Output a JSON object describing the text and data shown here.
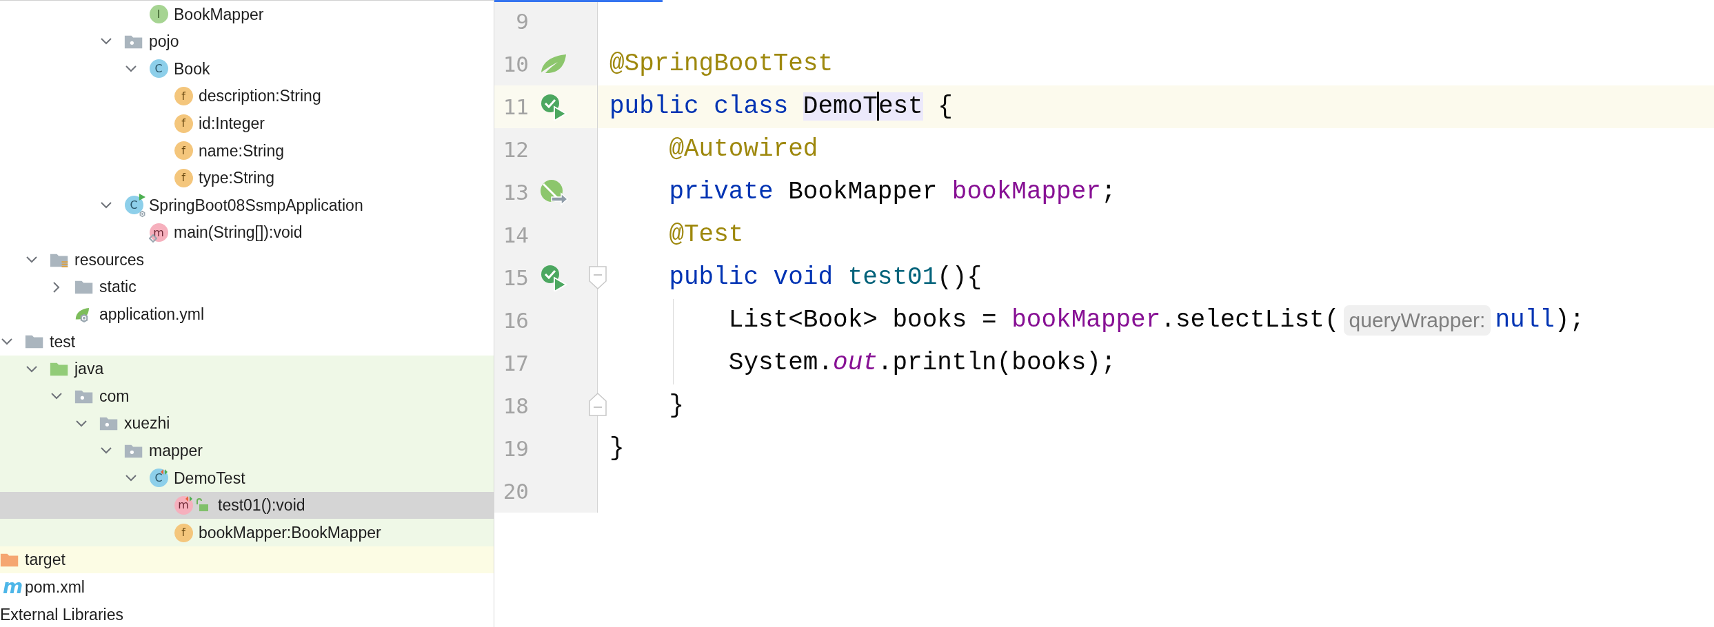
{
  "project_tree": {
    "fragments": [
      {
        "items": [
          {
            "label": "BookMapper",
            "kind": "interface",
            "badge": "I",
            "selected": false
          }
        ]
      },
      {
        "items": [
          {
            "label": "pojo",
            "kind": "package",
            "expanded": true,
            "selected": false,
            "children": [
              {
                "label": "Book",
                "kind": "class",
                "badge": "C",
                "expanded": true,
                "selected": false,
                "children": [
                  {
                    "label": "description:String",
                    "kind": "field",
                    "badge": "f",
                    "selected": false
                  },
                  {
                    "label": "id:Integer",
                    "kind": "field",
                    "badge": "f",
                    "selected": false
                  },
                  {
                    "label": "name:String",
                    "kind": "field",
                    "badge": "f",
                    "selected": false
                  },
                  {
                    "label": "type:String",
                    "kind": "field",
                    "badge": "f",
                    "selected": false
                  }
                ]
              }
            ]
          },
          {
            "label": "SpringBoot08SsmpApplication",
            "kind": "app-class",
            "badge": "C",
            "expanded": true,
            "selected": false,
            "children": [
              {
                "label": "main(String[]):void",
                "kind": "main-method",
                "badge": "m",
                "selected": false
              }
            ]
          }
        ]
      },
      {
        "items": [
          {
            "label": "resources",
            "kind": "resources",
            "expanded": true,
            "selected": false,
            "children": [
              {
                "label": "static",
                "kind": "folder",
                "expanded": false,
                "selected": false
              },
              {
                "label": "application.yml",
                "kind": "yml",
                "selected": false
              }
            ]
          }
        ]
      },
      {
        "items": [
          {
            "label": "test",
            "kind": "folder",
            "expanded": true,
            "selected": false,
            "children": [
              {
                "label": "java",
                "kind": "test-root",
                "expanded": true,
                "test_source": true,
                "selected": false,
                "children": [
                  {
                    "label": "com",
                    "kind": "package",
                    "expanded": true,
                    "test_source": true,
                    "selected": false,
                    "children": [
                      {
                        "label": "xuezhi",
                        "kind": "package",
                        "expanded": true,
                        "test_source": true,
                        "selected": false,
                        "children": [
                          {
                            "label": "mapper",
                            "kind": "package",
                            "expanded": true,
                            "test_source": true,
                            "selected": false,
                            "children": [
                              {
                                "label": "DemoTest",
                                "kind": "test-class",
                                "badge": "C",
                                "expanded": true,
                                "test_source": true,
                                "selected": false,
                                "children": [
                                  {
                                    "label": "test01():void",
                                    "kind": "test-method",
                                    "badge": "m",
                                    "package_private": true,
                                    "test_source": true,
                                    "selected": true
                                  },
                                  {
                                    "label": "bookMapper:BookMapper",
                                    "kind": "field",
                                    "badge": "f",
                                    "test_source": true,
                                    "selected": false
                                  }
                                ]
                              }
                            ]
                          }
                        ]
                      }
                    ]
                  }
                ]
              }
            ]
          }
        ]
      },
      {
        "items": [
          {
            "label": "target",
            "kind": "excluded",
            "excluded": true,
            "selected": false
          },
          {
            "label": "pom.xml",
            "kind": "maven",
            "badge": "m",
            "selected": false
          }
        ]
      },
      {
        "items": [
          {
            "label": "External Libraries",
            "kind": "library",
            "selected": false
          }
        ]
      }
    ]
  },
  "editor": {
    "lines": [
      {
        "number": "9",
        "current": false
      },
      {
        "number": "10",
        "gutter_icon": {
          "kind": "spring"
        },
        "current": false,
        "tokens": [
          {
            "text": "@SpringBootTest",
            "kind": "annotation"
          }
        ]
      },
      {
        "number": "11",
        "gutter_icon": {
          "kind": "run"
        },
        "current": true,
        "tokens": [
          {
            "text": "public class ",
            "kind": "keyword"
          },
          {
            "text": "DemoT",
            "kind": "usage",
            "caret": true
          },
          {
            "text": "est",
            "kind": "usage"
          },
          {
            "text": " {",
            "kind": "plain"
          }
        ],
        "children": [
          {
            "number": "12",
            "current": false,
            "tokens": [
              {
                "text": "@Autowired",
                "kind": "annotation"
              }
            ]
          },
          {
            "number": "13",
            "gutter_icon": {
              "kind": "bean"
            },
            "current": false,
            "tokens": [
              {
                "text": "private ",
                "kind": "keyword"
              },
              {
                "text": "BookMapper ",
                "kind": "plain"
              },
              {
                "text": "bookMapper",
                "kind": "field"
              },
              {
                "text": ";",
                "kind": "plain"
              }
            ]
          },
          {
            "number": "14",
            "current": false,
            "tokens": [
              {
                "text": "@Test",
                "kind": "annotation"
              }
            ]
          },
          {
            "number": "15",
            "gutter_icon": {
              "kind": "run"
            },
            "fold": {
              "kind": "start"
            },
            "current": false,
            "tokens": [
              {
                "text": "public void ",
                "kind": "keyword"
              },
              {
                "text": "test01",
                "kind": "method"
              },
              {
                "text": "(){",
                "kind": "plain"
              }
            ],
            "children": [
              {
                "number": "16",
                "current": false,
                "tokens": [
                  {
                    "text": "List<Book> books = ",
                    "kind": "plain"
                  },
                  {
                    "text": "bookMapper",
                    "kind": "field"
                  },
                  {
                    "text": ".selectList(",
                    "kind": "plain"
                  },
                  {
                    "text": "queryWrapper:",
                    "kind": "hint"
                  },
                  {
                    "text": "null",
                    "kind": "keyword"
                  },
                  {
                    "text": ");",
                    "kind": "plain"
                  }
                ]
              },
              {
                "number": "17",
                "current": false,
                "tokens": [
                  {
                    "text": "System.",
                    "kind": "plain"
                  },
                  {
                    "text": "out",
                    "kind": "static"
                  },
                  {
                    "text": ".println(books);",
                    "kind": "plain"
                  }
                ]
              }
            ]
          },
          {
            "number": "18",
            "fold": {
              "kind": "end"
            },
            "current": false,
            "tokens": [
              {
                "text": "}",
                "kind": "plain"
              }
            ]
          }
        ]
      },
      {
        "number": "19",
        "current": false,
        "tokens": [
          {
            "text": "}",
            "kind": "plain"
          }
        ]
      },
      {
        "number": "20",
        "current": false
      }
    ]
  }
}
